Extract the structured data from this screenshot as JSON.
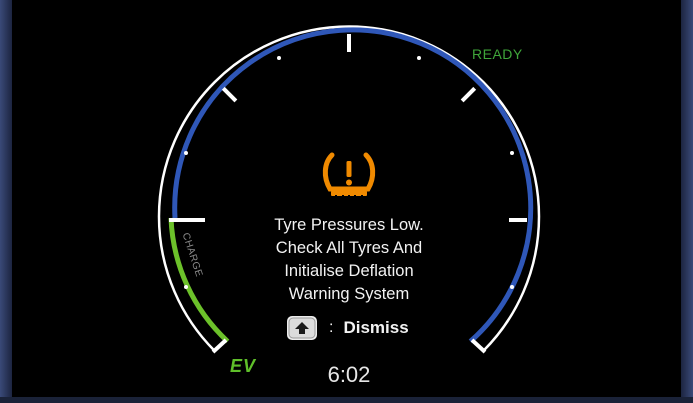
{
  "display": {
    "ready_label": "READY",
    "charge_label": "CHARGE",
    "ev_label": "EV",
    "clock": "6:02"
  },
  "warning": {
    "icon": "tyre-pressure-warning-icon",
    "message_lines": [
      "Tyre Pressures Low.",
      "Check All Tyres And",
      "Initialise Deflation",
      "Warning System"
    ],
    "dismiss_separator": ":",
    "dismiss_label": "Dismiss",
    "dismiss_button_icon": "enter-button-icon"
  },
  "colors": {
    "gauge_blue": "#2f57b8",
    "charge_green": "#6cc12a",
    "ready_green": "#3fa63a",
    "warning_amber": "#f08a00",
    "tick_white": "#ffffff",
    "background": "#000000"
  }
}
